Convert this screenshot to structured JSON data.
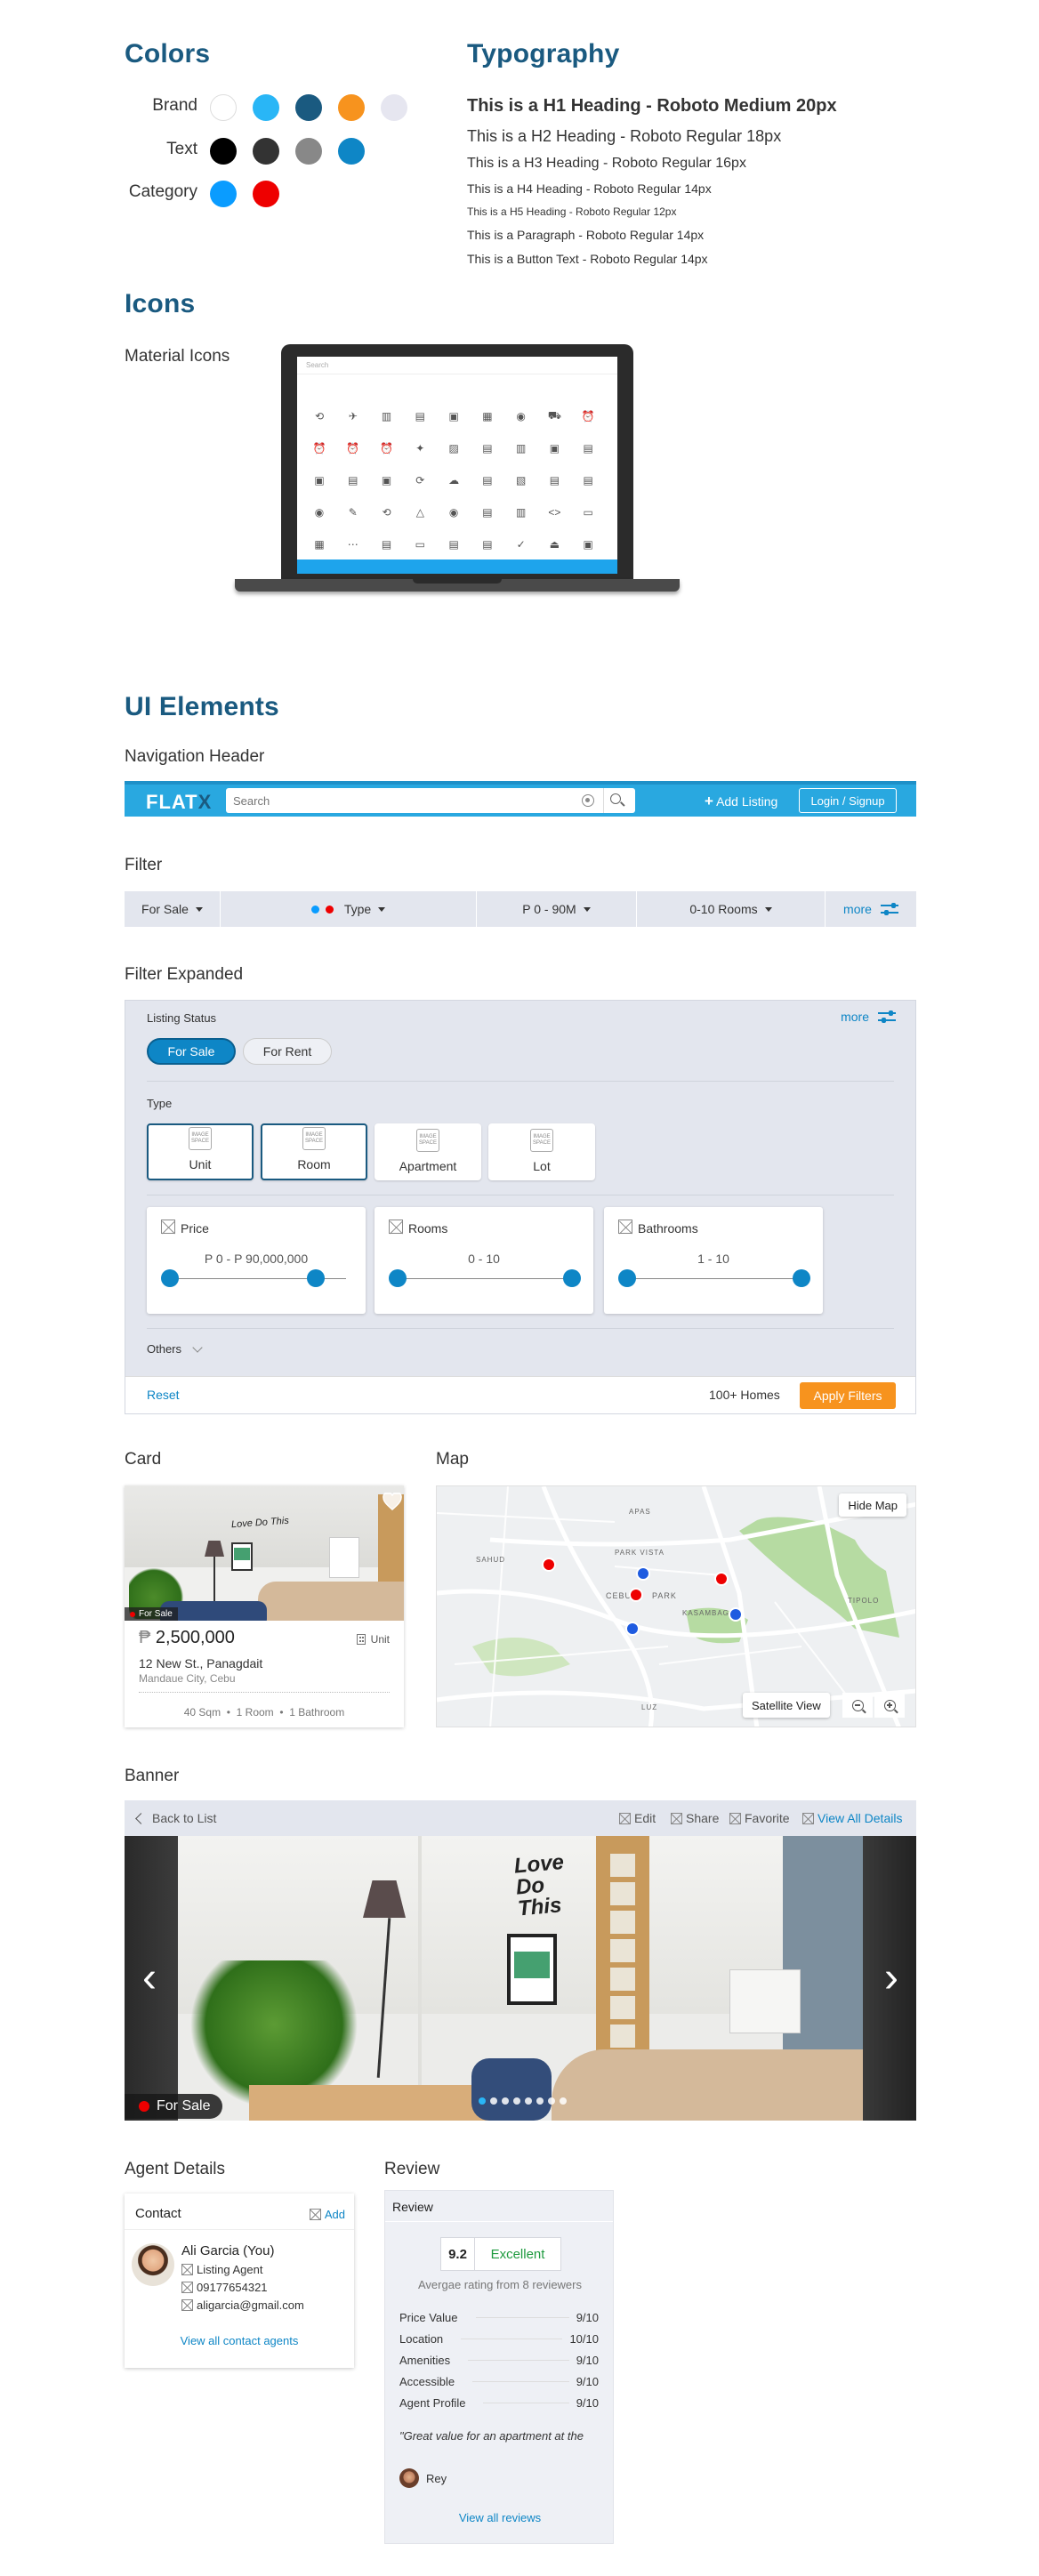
{
  "colors": {
    "title": "Colors",
    "brand_label": "Brand",
    "text_label": "Text",
    "category_label": "Category",
    "brand": [
      "#ffffff",
      "#29b6f6",
      "#1a5a80",
      "#f7931e",
      "#e6e6f0"
    ],
    "text": [
      "#000000",
      "#333333",
      "#888888",
      "#0e86c6"
    ],
    "category": [
      "#0a9cff",
      "#ee0000"
    ]
  },
  "typography": {
    "title": "Typography",
    "h1": "This is a H1 Heading - Roboto Medium 20px",
    "h2": "This is a H2 Heading - Roboto Regular 18px",
    "h3": "This is a H3 Heading - Roboto Regular 16px",
    "h4": "This is a H4 Heading - Roboto Regular 14px",
    "h5": "This is a H5 Heading - Roboto Regular 12px",
    "p": "This is a Paragraph - Roboto Regular 14px",
    "button": "This is a Button Text - Roboto Regular 14px"
  },
  "icons": {
    "title": "Icons",
    "subtitle": "Material Icons",
    "screen_search": "Search"
  },
  "ui": {
    "title": "UI Elements"
  },
  "nav": {
    "section": "Navigation Header",
    "logo_main": "FLAT",
    "logo_accent": "X",
    "search_placeholder": "Search",
    "add_listing": "Add Listing",
    "login": "Login / Signup"
  },
  "filter": {
    "section": "Filter",
    "status": "For Sale",
    "type": "Type",
    "price": "P 0 - 90M",
    "rooms": "0-10 Rooms",
    "more": "more"
  },
  "filter_expanded": {
    "section": "Filter Expanded",
    "listing_status": "Listing Status",
    "more": "more",
    "for_sale": "For Sale",
    "for_rent": "For Rent",
    "type_label": "Type",
    "image_placeholder": "IMAGE SPACE",
    "types": [
      "Unit",
      "Room",
      "Apartment",
      "Lot"
    ],
    "price_label": "Price",
    "price_value": "P 0 - P 90,000,000",
    "rooms_label": "Rooms",
    "rooms_value": "0 - 10",
    "baths_label": "Bathrooms",
    "baths_value": "1 - 10",
    "others": "Others",
    "reset": "Reset",
    "homes": "100+ Homes",
    "apply": "Apply Filters"
  },
  "card": {
    "section": "Card",
    "badge": "For Sale",
    "price": "2,500,000",
    "currency": "₱",
    "type": "Unit",
    "address": "12 New St., Panagdait",
    "city": "Mandaue City, Cebu",
    "meta": "40 Sqm  •  1 Room  •  1 Bathroom"
  },
  "map": {
    "section": "Map",
    "hide": "Hide Map",
    "satellite": "Satellite View",
    "labels": [
      "SAHUD",
      "PARK VISTA",
      "CEBU",
      "PARK",
      "KASAMBAGAN",
      "TIPOLO",
      "LUZ",
      "APAS"
    ]
  },
  "banner": {
    "section": "Banner",
    "back": "Back to List",
    "edit": "Edit",
    "share": "Share",
    "favorite": "Favorite",
    "view_all": "View All Details",
    "badge": "For Sale",
    "poster_text": "Love Do This",
    "prev": "‹",
    "next": "›"
  },
  "agent": {
    "section": "Agent Details",
    "contact": "Contact",
    "add": "Add",
    "name": "Ali Garcia (You)",
    "role": "Listing Agent",
    "phone": "09177654321",
    "email": "aligarcia@gmail.com",
    "view_all": "View all contact agents"
  },
  "review": {
    "section": "Review",
    "header": "Review",
    "score": "9.2",
    "verdict": "Excellent",
    "average": "Avergae rating from 8 reviewers",
    "rows": [
      {
        "label": "Price Value",
        "value": "9/10"
      },
      {
        "label": "Location",
        "value": "10/10"
      },
      {
        "label": "Amenities",
        "value": "9/10"
      },
      {
        "label": "Accessible",
        "value": "9/10"
      },
      {
        "label": "Agent Profile",
        "value": "9/10"
      }
    ],
    "quote": "\"Great value for an apartment at the",
    "reviewer": "Rey",
    "view_all": "View all reviews"
  }
}
